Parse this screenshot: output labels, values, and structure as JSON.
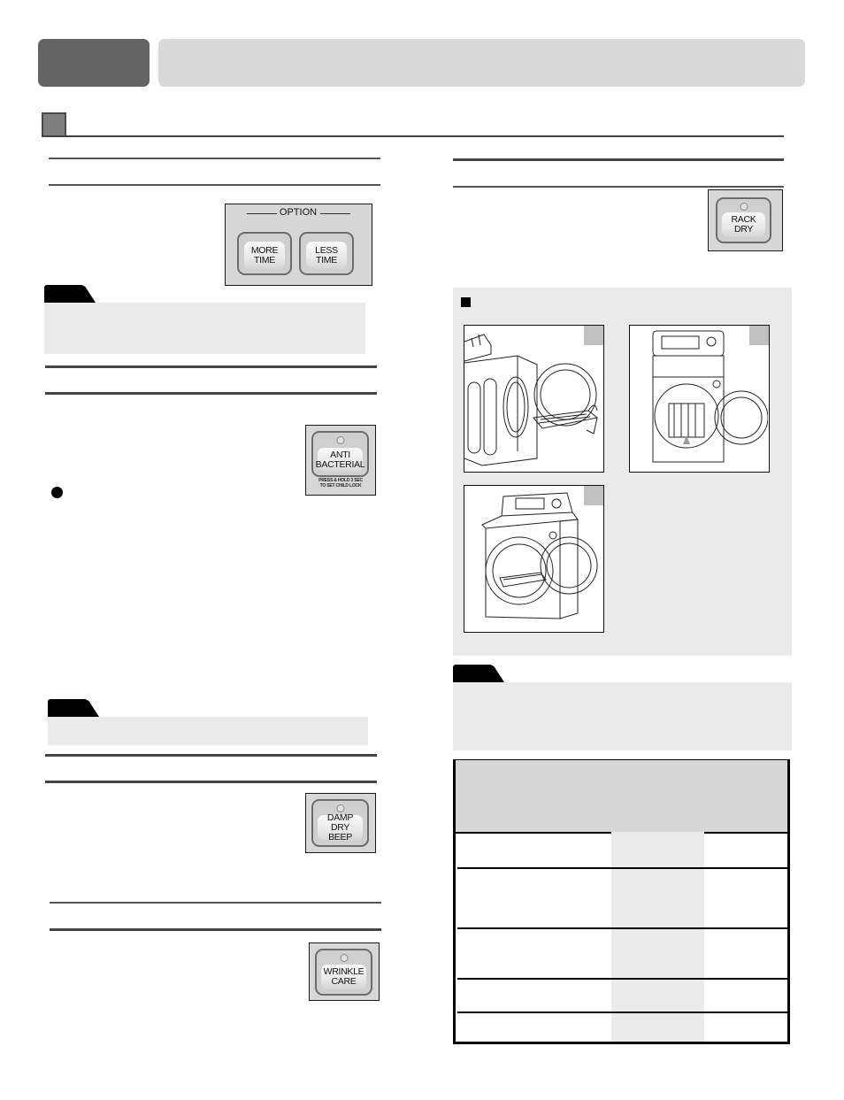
{
  "header": {
    "chapter_tab": "",
    "chapter_title": ""
  },
  "section": {
    "number": "",
    "title": ""
  },
  "left_column": {
    "option_panel": {
      "group_label": "OPTION",
      "buttons": [
        {
          "line1": "MORE",
          "line2": "TIME"
        },
        {
          "line1": "LESS",
          "line2": "TIME"
        }
      ]
    },
    "anti_bacterial_button": {
      "line1": "ANTI",
      "line2": "BACTERIAL",
      "caption1": "PRESS & HOLD 3 SEC",
      "caption2": "TO SET CHILD LOCK"
    },
    "damp_dry_beep_button": {
      "line1": "DAMP DRY",
      "line2": "BEEP"
    },
    "wrinkle_care_button": {
      "line1": "WRINKLE",
      "line2": "CARE"
    }
  },
  "right_column": {
    "rack_dry_button": {
      "line1": "RACK",
      "line2": "DRY"
    },
    "figures": [
      {
        "name": "rack-install-side-view",
        "number": ""
      },
      {
        "name": "rack-install-front-view",
        "number": ""
      },
      {
        "name": "rack-installed-view",
        "number": ""
      }
    ],
    "spec_table": {
      "rows": 5,
      "columns": 3
    }
  }
}
